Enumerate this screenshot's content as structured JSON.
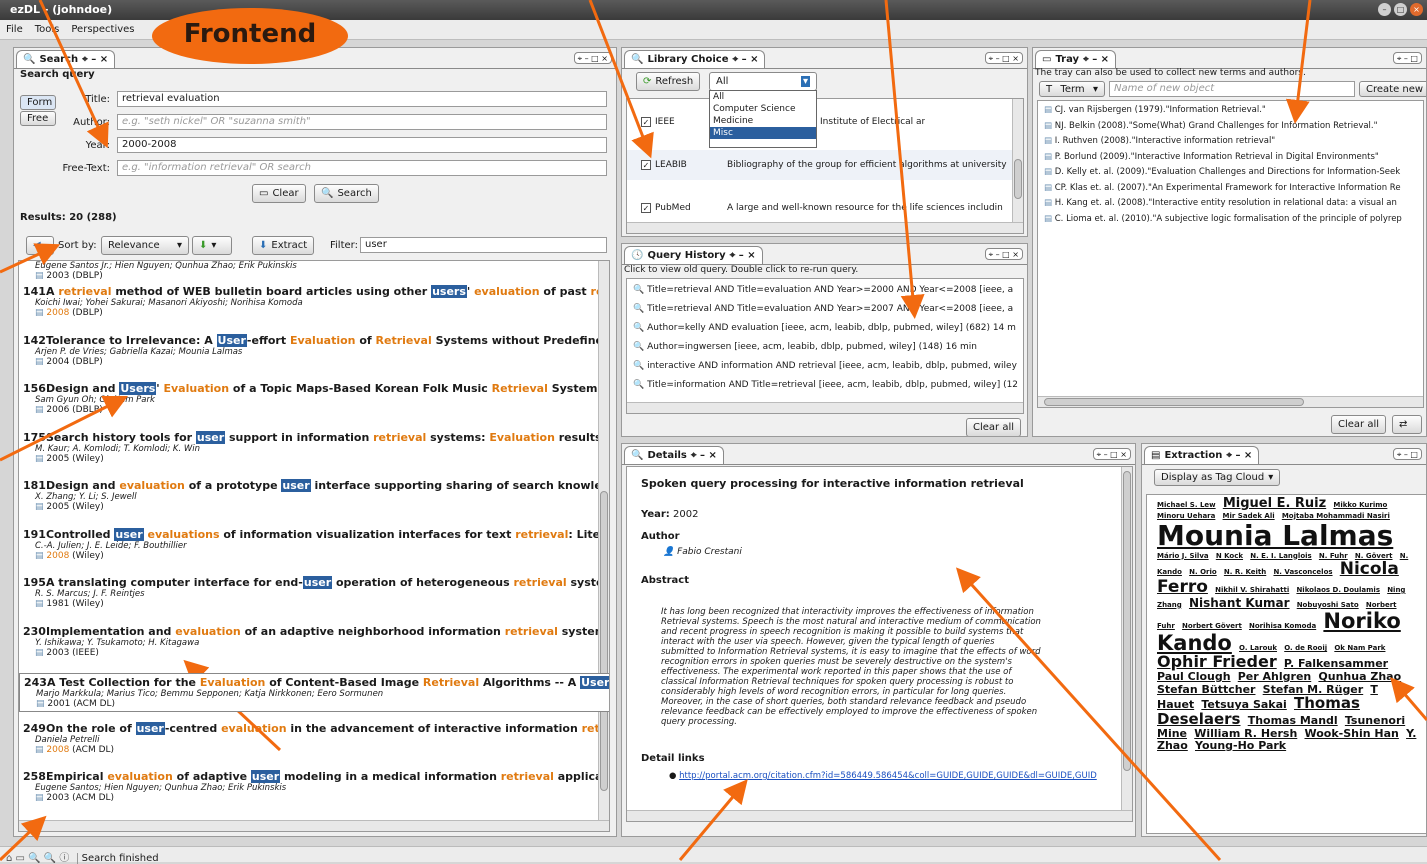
{
  "window": {
    "title": "ezDL - (johndoe)"
  },
  "badge": "Frontend",
  "menu": [
    "File",
    "Tools",
    "Perspectives"
  ],
  "search": {
    "tab": "Search",
    "heading": "Search query",
    "mode_form": "Form",
    "mode_free": "Free",
    "title_label": "Title:",
    "title_value": "retrieval evaluation",
    "author_label": "Author:",
    "author_placeholder": "e.g. \"seth nickel\" OR \"suzanna smith\"",
    "year_label": "Year:",
    "year_value": "2000-2008",
    "freetext_label": "Free-Text:",
    "freetext_placeholder": "e.g. \"information retrieval\" OR search",
    "clear": "Clear",
    "search": "Search",
    "results_label": "Results: 20 (288)",
    "sortby_label": "Sort by:",
    "sortby_value": "Relevance",
    "extract": "Extract",
    "filter_label": "Filter:",
    "filter_value": "user"
  },
  "results": [
    {
      "num": "",
      "title": "",
      "authors": "Eugene Santos Jr.; Hien Nguyen; Qunhua Zhao; Erik Pukinskis",
      "year": "2003",
      "source": "(DBLP)"
    },
    {
      "num": "141",
      "title": "A retrieval method of WEB bulletin board articles using other users' evaluation of past retrieva",
      "authors": "Koichi Iwai; Yohei Sakurai; Masanori Akiyoshi; Norihisa Komoda",
      "year": "2008",
      "source": "(DBLP)"
    },
    {
      "num": "142",
      "title": "Tolerance to Irrelevance: A User-effort Evaluation of Retrieval Systems without Predefined Re",
      "authors": "Arjen P. de Vries; Gabriella Kazai; Mounia Lalmas",
      "year": "2004",
      "source": "(DBLP)"
    },
    {
      "num": "156",
      "title": "Design and Users' Evaluation of a Topic Maps-Based Korean Folk Music Retrieval System.",
      "authors": "Sam Gyun Oh; Ok Nam Park",
      "year": "2006",
      "source": "(DBLP)"
    },
    {
      "num": "175",
      "title": "Search history tools for user support in information retrieval systems: Evaluation results from",
      "authors": "M. Kaur; A. Komlodi; T. Komlodi; K. Win",
      "year": "2005",
      "source": "(Wiley)"
    },
    {
      "num": "181",
      "title": "Design and evaluation of a prototype user interface supporting sharing of search knowledge i",
      "authors": "X. Zhang; Y. Li; S. Jewell",
      "year": "2005",
      "source": "(Wiley)"
    },
    {
      "num": "191",
      "title": "Controlled user evaluations of information visualization interfaces for text retrieval: Literature",
      "authors": "C.-A. Julien; J. E. Leide; F. Bouthillier",
      "year": "2008",
      "source": "(Wiley)"
    },
    {
      "num": "195",
      "title": "A translating computer interface for end-user operation of heterogeneous retrieval systems.",
      "authors": "R. S. Marcus; J. F. Reintjes",
      "year": "1981",
      "source": "(Wiley)"
    },
    {
      "num": "230",
      "title": "Implementation and evaluation of an adaptive neighborhood information retrieval system for m",
      "authors": "Y. Ishikawa; Y. Tsukamoto; H. Kitagawa",
      "year": "2003",
      "source": "(IEEE)"
    },
    {
      "num": "243",
      "title": "A Test Collection for the Evaluation of Content-Based Image Retrieval Algorithms -- A User and Task-Based Approach",
      "authors": "Marjo Markkula; Marius Tico; Bemmu Sepponen; Katja Nirkkonen; Eero Sormunen",
      "year": "2001",
      "source": "(ACM DL)"
    },
    {
      "num": "249",
      "title": "On the role of user-centred evaluation in the advancement of interactive information retrieval",
      "authors": "Daniela Petrelli",
      "year": "2008",
      "source": "(ACM DL)"
    },
    {
      "num": "258",
      "title": "Empirical evaluation of adaptive user modeling in a medical information retrieval application",
      "authors": "Eugene Santos; Hien Nguyen; Qunhua Zhao; Erik Pukinskis",
      "year": "2003",
      "source": "(ACM DL)"
    }
  ],
  "library": {
    "tab": "Library Choice",
    "refresh": "Refresh",
    "filter_value": "All",
    "dropdown_options": [
      "All",
      "Computer Science",
      "Medicine",
      "Misc"
    ],
    "items": [
      {
        "name": "IEEE",
        "desc": "Digital library of the Institute of Electrical ar"
      },
      {
        "name": "LEABIB",
        "desc": "Bibliography of the group for efficient algorithms at university"
      },
      {
        "name": "PubMed",
        "desc": "A large and well-known resource for the life sciences includin"
      }
    ]
  },
  "history": {
    "tab": "Query History",
    "hint": "Click to view old query. Double click to re-run query.",
    "items": [
      "Title=retrieval AND Title=evaluation AND Year>=2000 AND Year<=2008 [ieee, a",
      "Title=retrieval AND Title=evaluation AND Year>=2007 AND Year<=2008 [ieee, a",
      "Author=kelly AND evaluation [ieee, acm, leabib, dblp, pubmed, wiley] (682) 14 m",
      "Author=ingwersen [ieee, acm, leabib, dblp, pubmed, wiley] (148) 16 min",
      "interactive AND information AND retrieval [ieee, acm, leabib, dblp, pubmed, wiley",
      "Title=information AND Title=retrieval [ieee, acm, leabib, dblp, pubmed, wiley] (12"
    ],
    "clear_all": "Clear all"
  },
  "tray": {
    "tab": "Tray",
    "hint": "The tray can also be used to collect new terms and authors.",
    "type_value": "Term",
    "name_placeholder": "Name of new object",
    "create_new": "Create new",
    "items": [
      "CJ. van Rijsbergen (1979).\"Information Retrieval.\"",
      "NJ. Belkin (2008).\"Some(What) Grand Challenges for Information Retrieval.\"",
      "I. Ruthven (2008).\"Interactive information retrieval\"",
      "P. Borlund (2009).\"Interactive Information Retrieval in Digital Environments\"",
      "D. Kelly et. al. (2009).\"Evaluation Challenges and Directions for Information-Seek",
      "CP. Klas et. al. (2007).\"An Experimental Framework for Interactive Information Re",
      "H. Kang et. al. (2008).\"Interactive entity resolution in relational data: a visual an",
      "C. Lioma et. al. (2010).\"A subjective logic formalisation of the principle of polyrep"
    ],
    "clear_all": "Clear all"
  },
  "details": {
    "tab": "Details",
    "title": "Spoken query processing for interactive information retrieval",
    "year_label": "Year:",
    "year_value": "2002",
    "author_heading": "Author",
    "author": "Fabio Crestani",
    "abstract_heading": "Abstract",
    "abstract_lines": [
      "It has long been recognized that interactivity improves the effectiveness of information",
      "Retrieval systems. Speech is the most natural and interactive medium of communication",
      "and recent progress in speech recognition is making it possible to build systems that",
      "interact with the user via speech. However, given the typical length of queries",
      "submitted to Information Retrieval systems, it is easy to imagine that the effects of word",
      "recognition errors in spoken queries must be severely destructive on the system's",
      "effectiveness. The experimental work reported in this paper shows that the use of",
      "classical Information Retrieval techniques for spoken query processing is robust to",
      "considerably high levels of word recognition errors, in particular for long queries.",
      "Moreover, in the case of short queries, both standard relevance feedback and pseudo",
      "relevance feedback can be effectively employed to improve the effectiveness of spoken",
      "query processing."
    ],
    "links_heading": "Detail links",
    "link": "http://portal.acm.org/citation.cfm?id=586449.586454&coll=GUIDE,GUIDE,GUIDE&dl=GUIDE,GUID"
  },
  "extraction": {
    "tab": "Extraction",
    "display_mode": "Display as Tag Cloud",
    "tags": [
      {
        "t": "Michael S. Lew",
        "s": 7
      },
      {
        "t": "Miguel E. Ruiz",
        "s": 13
      },
      {
        "t": "Mikko Kurimo",
        "s": 7
      },
      {
        "t": "Minoru Uehara",
        "s": 7
      },
      {
        "t": "Mir Sadek Ali",
        "s": 7
      },
      {
        "t": "Mojtaba Mohammadi Nasiri",
        "s": 7
      },
      {
        "t": "Mounia Lalmas",
        "s": 28
      },
      {
        "t": "Mário J. Silva",
        "s": 7
      },
      {
        "t": "N Kock",
        "s": 7
      },
      {
        "t": "N. E. I. Langlois",
        "s": 7
      },
      {
        "t": "N. Fuhr",
        "s": 7
      },
      {
        "t": "N. Gövert",
        "s": 7
      },
      {
        "t": "N. Kando",
        "s": 7
      },
      {
        "t": "N. Orio",
        "s": 7
      },
      {
        "t": "N. R. Keith",
        "s": 7
      },
      {
        "t": "N. Vasconcelos",
        "s": 7
      },
      {
        "t": "Nicola Ferro",
        "s": 17
      },
      {
        "t": "Nikhil V. Shirahatti",
        "s": 7
      },
      {
        "t": "Nikolaos D. Doulamis",
        "s": 7
      },
      {
        "t": "Ning Zhang",
        "s": 7
      },
      {
        "t": "Nishant Kumar",
        "s": 12
      },
      {
        "t": "Nobuyoshi Sato",
        "s": 7
      },
      {
        "t": "Norbert Fuhr",
        "s": 7
      },
      {
        "t": "Norbert Gövert",
        "s": 7
      },
      {
        "t": "Norihisa Komoda",
        "s": 7
      },
      {
        "t": "Noriko Kando",
        "s": 21
      },
      {
        "t": "O. Larouk",
        "s": 7
      },
      {
        "t": "O. de Rooij",
        "s": 7
      },
      {
        "t": "Ok Nam Park",
        "s": 7
      },
      {
        "t": "Ophir Frieder",
        "s": 16
      },
      {
        "t": "P. Falkensammer",
        "s": 11
      },
      {
        "t": "Paul Clough",
        "s": 11
      },
      {
        "t": "Per Ahlgren",
        "s": 11
      },
      {
        "t": "Qunhua Zhao",
        "s": 11
      },
      {
        "t": "Stefan Büttcher",
        "s": 11
      },
      {
        "t": "Stefan M. Rüger",
        "s": 11
      },
      {
        "t": "T Hauet",
        "s": 11
      },
      {
        "t": "Tetsuya Sakai",
        "s": 11
      },
      {
        "t": "Thomas Deselaers",
        "s": 15
      },
      {
        "t": "Thomas Mandl",
        "s": 11
      },
      {
        "t": "Tsunenori Mine",
        "s": 11
      },
      {
        "t": "William R. Hersh",
        "s": 11
      },
      {
        "t": "Wook-Shin Han",
        "s": 11
      },
      {
        "t": "Y. Zhao",
        "s": 11
      },
      {
        "t": "Young-Ho Park",
        "s": 11
      }
    ]
  },
  "status": {
    "text": "Search finished"
  }
}
